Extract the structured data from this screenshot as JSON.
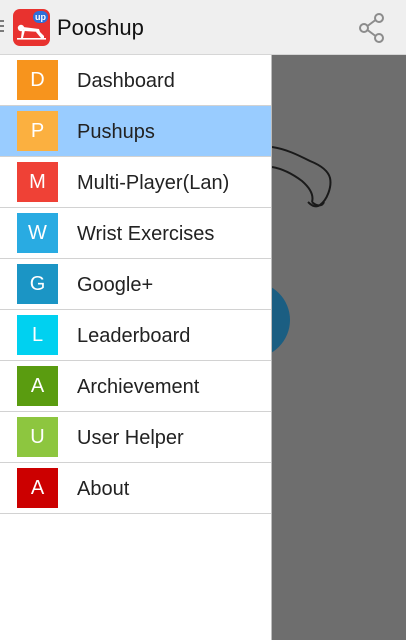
{
  "app": {
    "title": "Pooshup",
    "logo_badge": "up",
    "logo_icon": "pushup-figure-icon",
    "share_icon": "share-icon"
  },
  "drawer": {
    "active_color": "#99ccff",
    "items": [
      {
        "letter": "D",
        "label": "Dashboard",
        "color": "#f7941d",
        "active": false
      },
      {
        "letter": "P",
        "label": "Pushups",
        "color": "#fbb040",
        "active": true
      },
      {
        "letter": "M",
        "label": "Multi-Player(Lan)",
        "color": "#ef4136",
        "active": false
      },
      {
        "letter": "W",
        "label": "Wrist Exercises",
        "color": "#29abe2",
        "active": false
      },
      {
        "letter": "G",
        "label": "Google+",
        "color": "#1b95c5",
        "active": false
      },
      {
        "letter": "L",
        "label": "Leaderboard",
        "color": "#00d1f0",
        "active": false
      },
      {
        "letter": "A",
        "label": "Archievement",
        "color": "#5a9c10",
        "active": false
      },
      {
        "letter": "U",
        "label": "User Helper",
        "color": "#8dc63f",
        "active": false
      },
      {
        "letter": "A",
        "label": "About",
        "color": "#cc0000",
        "active": false
      }
    ]
  },
  "background": {
    "overlay_color": "#6e6e6e",
    "circle_color": "#1b5e82"
  }
}
